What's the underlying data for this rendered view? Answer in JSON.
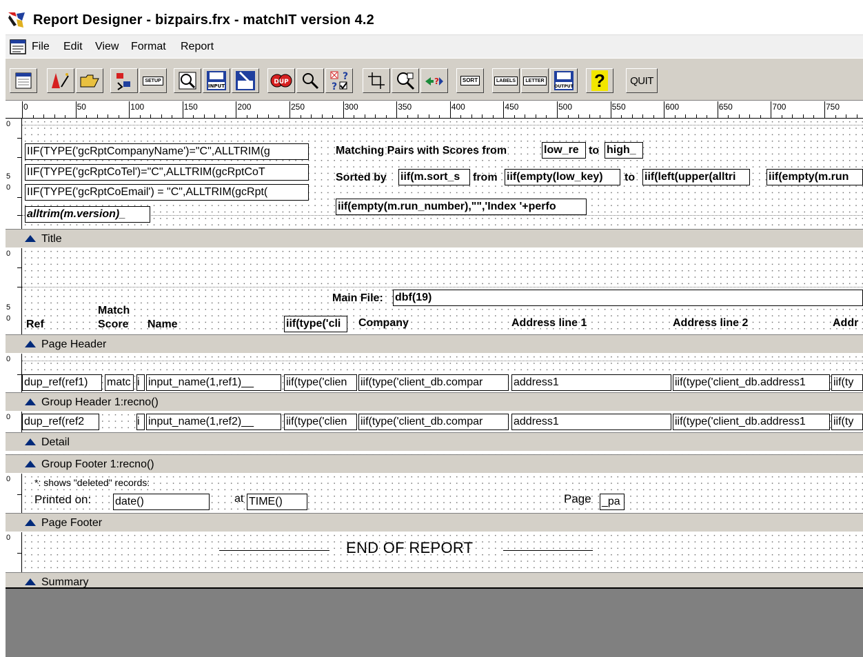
{
  "window": {
    "title": "Report Designer - bizpairs.frx - matchIT version 4.2"
  },
  "menu": {
    "items": [
      "File",
      "Edit",
      "View",
      "Format",
      "Report"
    ]
  },
  "toolbar": {
    "setup_label": "SETUP",
    "input_label": "INPUT",
    "sort_label": "SORT",
    "labels_label": "LABELS",
    "letter_label": "LETTER",
    "output_label": "OUTPUT",
    "quit_label": "QUIT",
    "help_glyph": "?"
  },
  "ruler": {
    "labels": [
      "0",
      "50",
      "100",
      "150",
      "200",
      "250",
      "300",
      "350",
      "400",
      "450",
      "500",
      "550",
      "600",
      "650",
      "700",
      "750"
    ]
  },
  "vruler": {
    "zero": "0",
    "five": "5"
  },
  "bands": {
    "title": {
      "label": "Title",
      "f1": "IIF(TYPE('gcRptCompanyName')=\"C\",ALLTRIM(g",
      "f2": "IIF(TYPE('gcRptCoTel')=\"C\",ALLTRIM(gcRptCoT",
      "f3": "IIF(TYPE('gcRptCoEmail') = \"C\",ALLTRIM(gcRpt(",
      "f4": "alltrim(m.version)_",
      "l1": "Matching Pairs with Scores from",
      "f5": "low_re",
      "l2": "to",
      "f6": "high_",
      "l3": "Sorted by",
      "f7": "iif(m.sort_s",
      "l4": "from",
      "f8": "iif(empty(low_key)",
      "l5": "to",
      "f9": "iif(left(upper(alltri",
      "f10": "iif(empty(m.run",
      "f11": "iif(empty(m.run_number),\"\",'Index '+perfo"
    },
    "page_header": {
      "label": "Page Header",
      "main_file_label": "Main File:",
      "main_file_field": "dbf(19)",
      "col_ref": "Ref",
      "col_match": "Match",
      "col_score": "Score",
      "col_name": "Name",
      "col_type": "iif(type('cli",
      "col_company": "Company",
      "col_addr1": "Address line 1",
      "col_addr2": "Address line 2",
      "col_addr3": "Addr"
    },
    "group_header": {
      "label": "Group Header 1:recno()",
      "f1": "dup_ref(ref1)",
      "f2": "matc",
      "f3": "i",
      "f4": "input_name(1,ref1)__",
      "f5": "iif(type('clien",
      "f6": "iif(type('client_db.compar",
      "f7": "address1",
      "f8": "iif(type('client_db.address1",
      "f9": "iif(ty"
    },
    "detail": {
      "label": "Detail",
      "f1": "dup_ref(ref2",
      "f3": "i",
      "f4": "input_name(1,ref2)__",
      "f5": "iif(type('clien",
      "f6": "iif(type('client_db.compar",
      "f7": "address1",
      "f8": "iif(type('client_db.address1",
      "f9": "iif(ty"
    },
    "group_footer": {
      "label": "Group Footer 1:recno()"
    },
    "page_footer": {
      "label": "Page Footer",
      "note": "*: shows \"deleted\" records:",
      "printed_on": "Printed on:",
      "date_field": "date()",
      "at_label": "at",
      "time_field": "TIME()",
      "page_label": "Page",
      "page_field": "_pa"
    },
    "summary": {
      "label": "Summary",
      "end_text": "END OF REPORT"
    }
  }
}
